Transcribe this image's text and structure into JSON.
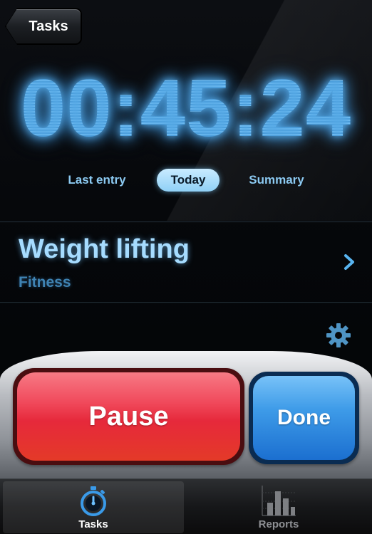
{
  "nav": {
    "back_label": "Tasks"
  },
  "timer": {
    "display": "00:45:24"
  },
  "segments": {
    "last_entry": "Last entry",
    "today": "Today",
    "summary": "Summary",
    "selected": "today"
  },
  "task": {
    "name": "Weight lifting",
    "category": "Fitness"
  },
  "controls": {
    "pause_label": "Pause",
    "done_label": "Done"
  },
  "tabbar": {
    "tasks_label": "Tasks",
    "reports_label": "Reports",
    "selected": "tasks"
  },
  "icons": {
    "chevron": "chevron-right-icon",
    "settings": "gear-icon",
    "tasks_tab": "stopwatch-icon",
    "reports_tab": "bar-chart-icon"
  },
  "colors": {
    "accent": "#3c8fc8",
    "pause": "#e6293b",
    "done": "#1b6fd0"
  }
}
